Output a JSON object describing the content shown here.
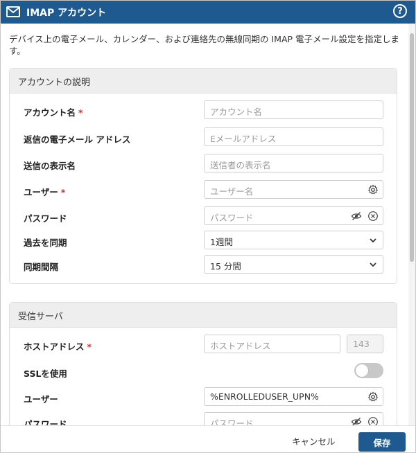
{
  "dialog": {
    "title": "IMAP アカウント",
    "help_label": "?",
    "description": "デバイス上の電子メール、カレンダー、および連絡先の無線同期の IMAP 電子メール設定を指定します。"
  },
  "account_section": {
    "title": "アカウントの説明",
    "fields": {
      "account_name": {
        "label": "アカウント名",
        "required": "*",
        "placeholder": "アカウント名"
      },
      "reply_email": {
        "label": "返信の電子メール アドレス",
        "placeholder": "Eメールアドレス"
      },
      "sender_display_name": {
        "label": "送信の表示名",
        "placeholder": "送信者の表示名"
      },
      "user": {
        "label": "ユーザー",
        "required": "*",
        "placeholder": "ユーザー名"
      },
      "password": {
        "label": "パスワード",
        "placeholder": "パスワード"
      },
      "past_sync": {
        "label": "過去を同期",
        "value": "1週間"
      },
      "sync_interval": {
        "label": "同期間隔",
        "value": "15 分間"
      }
    }
  },
  "incoming_section": {
    "title": "受信サーバ",
    "fields": {
      "host_address": {
        "label": "ホストアドレス",
        "required": "*",
        "placeholder": "ホストアドレス",
        "port_placeholder": "143"
      },
      "use_ssl": {
        "label": "SSLを使用",
        "enabled": false
      },
      "user": {
        "label": "ユーザー",
        "value": "%ENROLLEDUSER_UPN%"
      },
      "password": {
        "label": "パスワード",
        "placeholder": "パスワード"
      }
    }
  },
  "footer": {
    "cancel_label": "キャンセル",
    "save_label": "保存"
  },
  "colors": {
    "titlebar": "#1e5a8f",
    "required": "#d0332b",
    "primary_button": "#1e5a8f"
  },
  "icons": {
    "title": "mail-icon",
    "help": "help-icon",
    "user_field": "gear-icon",
    "password_visibility": "eye-off-icon",
    "password_clear": "clear-icon",
    "dropdown": "chevron-down-icon"
  }
}
